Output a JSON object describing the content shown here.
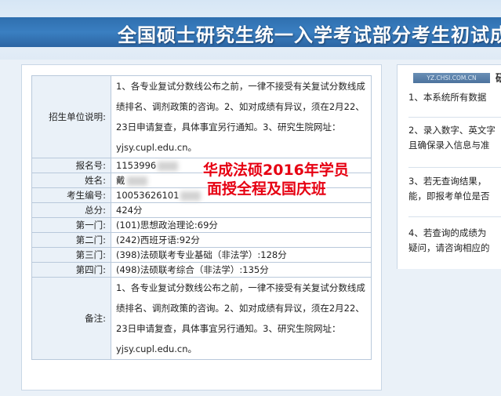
{
  "banner": {
    "title": "全国硕士研究生统一入学考试部分考生初试成"
  },
  "records": [
    {
      "label": "招生单位说明:",
      "value": "1、各专业复试分数线公布之前，一律不接受有关复试分数线成绩排名、调剂政策的咨询。2、如对成绩有异议，须在2月22、23日申请复查，具体事宜另行通知。3、研究生院网址：yjsy.cupl.edu.cn。"
    },
    {
      "label": "报名号:",
      "value": "1153996"
    },
    {
      "label": "姓名:",
      "value": "戴"
    },
    {
      "label": "考生编号:",
      "value": "10053626101"
    },
    {
      "label": "总分:",
      "value": "424分"
    },
    {
      "label": "第一门:",
      "value": "(101)思想政治理论:69分"
    },
    {
      "label": "第二门:",
      "value": "(242)西班牙语:92分"
    },
    {
      "label": "第三门:",
      "value": "(398)法硕联考专业基础（非法学）:128分"
    },
    {
      "label": "第四门:",
      "value": "(498)法硕联考综合（非法学）:135分"
    },
    {
      "label": "备注:",
      "value": "1、各专业复试分数线公布之前，一律不接受有关复试分数线成绩排名、调剂政策的咨询。2、如对成绩有异议，须在2月22、23日申请复查，具体事宜另行通知。3、研究生院网址：yjsy.cupl.edu.cn。"
    }
  ],
  "overlay": {
    "line1": "华成法硕2016年学员",
    "line2": "面授全程及国庆班"
  },
  "sidebar": {
    "tag": "YZ.CHSI.COM.CN",
    "title": "研",
    "items": [
      {
        "lines": [
          "1、本系统所有数据"
        ]
      },
      {
        "lines": [
          "2、录入数字、英文字",
          "且确保录入信息与准"
        ]
      },
      {
        "lines": [
          "3、若无查询结果，",
          "能，即报考单位是否"
        ]
      },
      {
        "lines": [
          "4、若查询的成绩为",
          "疑问，请咨询相应的"
        ]
      }
    ]
  },
  "colors": {
    "banner_blue": "#2f6fae",
    "label_bg": "#eaf1f8",
    "overlay_red": "#e60012"
  }
}
